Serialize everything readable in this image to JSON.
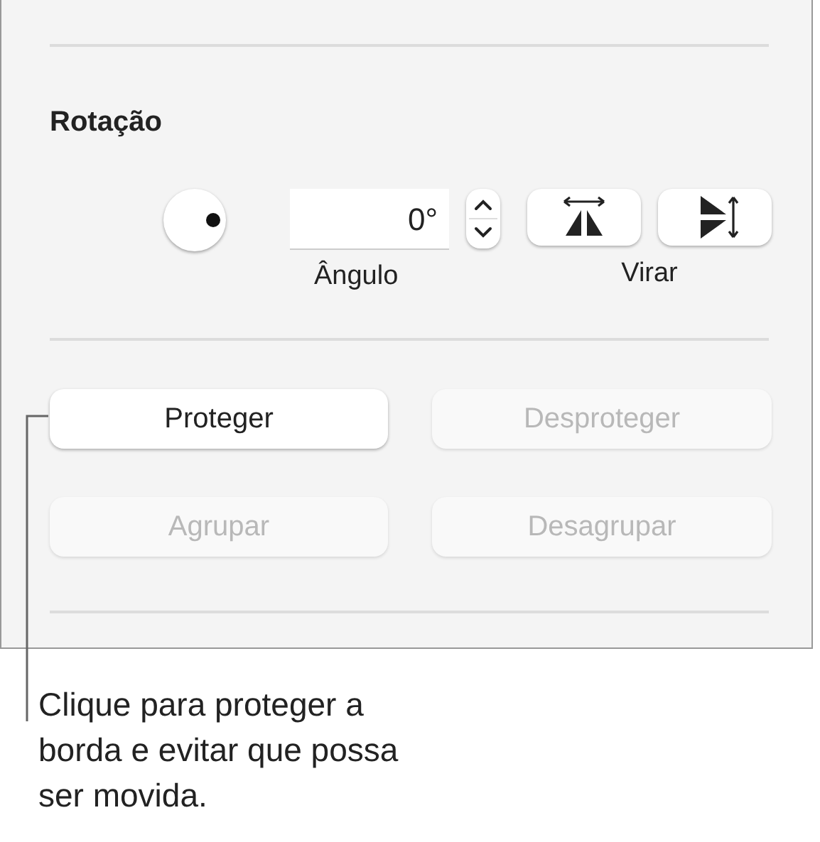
{
  "rotation": {
    "heading": "Rotação",
    "angle_value": "0°",
    "angle_label": "Ângulo",
    "flip_label": "Virar"
  },
  "buttons": [
    {
      "label": "Proteger",
      "disabled": false
    },
    {
      "label": "Desproteger",
      "disabled": true
    },
    {
      "label": "Agrupar",
      "disabled": true
    },
    {
      "label": "Desagrupar",
      "disabled": true
    }
  ],
  "callout": "Clique para proteger a borda e evitar que possa ser movida."
}
